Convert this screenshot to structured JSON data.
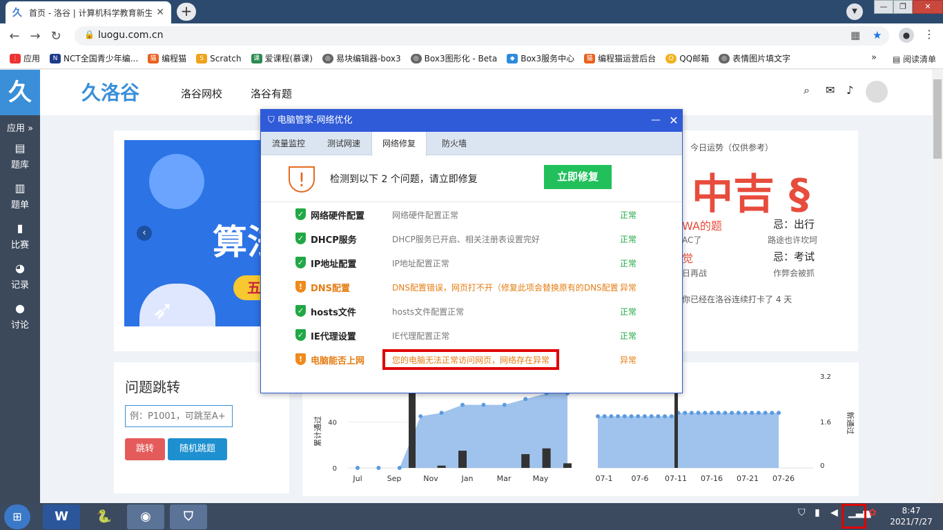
{
  "browser": {
    "tab_title": "首页 - 洛谷 | 计算机科学教育新生态",
    "url": "luogu.com.cn",
    "bookmarks": [
      "应用",
      "NCT全国青少年编...",
      "编程猫",
      "Scratch",
      "爱课程(慕课)",
      "易块编辑器-box3",
      "Box3图形化 - Beta",
      "Box3服务中心",
      "编程猫运营后台",
      "QQ邮箱",
      "表情图片填文字"
    ],
    "more": "»",
    "reading_list": "阅读清单"
  },
  "site": {
    "brand": "洛谷",
    "nav": [
      "洛谷网校",
      "洛谷有题"
    ],
    "sidebar": [
      "应用 »",
      "题库",
      "题单",
      "比赛",
      "记录",
      "讨论"
    ],
    "banner_text": "算法",
    "banner_badge": "五",
    "fortune_label": "今日运势（仅供参考）",
    "fortune_value": "中吉 §",
    "fortune_good_1": "WA的题",
    "fortune_good_1_sub": "AC了",
    "fortune_bad_1": "忌：出行",
    "fortune_bad_1_sub": "路途也许坎坷",
    "fortune_good_2": "觉",
    "fortune_good_2_sub": "日再战",
    "fortune_bad_2": "忌：考试",
    "fortune_bad_2_sub": "作弊会被抓",
    "streak": "你已经在洛谷连续打卡了 4 天",
    "jump_title": "问题跳转",
    "jump_placeholder": "例：P1001，可跳至A+",
    "jump_button": "跳转",
    "random_button": "随机跳题"
  },
  "chart_data": [
    {
      "type": "bar",
      "categories": [
        "Jul",
        "Sep",
        "Nov",
        "Jan",
        "Mar",
        "May"
      ],
      "ylabel": "累计通过",
      "yticks": [
        0,
        40
      ],
      "cumulative_values": [
        0,
        0,
        0,
        45,
        48,
        55,
        55,
        55,
        60,
        65,
        65
      ],
      "bar_values": [
        0,
        0,
        0,
        0,
        2,
        15,
        0,
        0,
        12,
        17,
        4
      ]
    },
    {
      "type": "area",
      "categories": [
        "07-1",
        "07-6",
        "07-11",
        "07-16",
        "07-21",
        "07-26"
      ],
      "ylabel": "新通过",
      "yticks": [
        0,
        1.6,
        3.2
      ],
      "values": [
        0,
        0,
        0,
        0,
        0,
        0,
        0,
        0,
        0,
        0,
        0,
        0,
        0,
        0,
        0,
        0,
        0,
        0,
        0,
        0,
        0,
        0,
        0,
        0,
        0,
        0,
        0,
        0,
        0,
        0
      ],
      "area_level": [
        45,
        45,
        45,
        45,
        45,
        45,
        45,
        45,
        45,
        45,
        45,
        45,
        48,
        48,
        48,
        48,
        48,
        48,
        48,
        48,
        48,
        48,
        48,
        48,
        48,
        48,
        48,
        48
      ]
    }
  ],
  "dialog": {
    "title": "电脑管家-网络优化",
    "tabs": [
      "流量监控",
      "测试网速",
      "网络修复",
      "防火墙"
    ],
    "active_tab": 2,
    "message": "检测到以下 2 个问题，请立即修复",
    "fix_button": "立即修复",
    "rows": [
      {
        "name": "网络硬件配置",
        "desc": "网络硬件配置正常",
        "status": "正常",
        "ok": true
      },
      {
        "name": "DHCP服务",
        "desc": "DHCP服务已开启、相关注册表设置完好",
        "status": "正常",
        "ok": true
      },
      {
        "name": "IP地址配置",
        "desc": "IP地址配置正常",
        "status": "正常",
        "ok": true
      },
      {
        "name": "DNS配置",
        "desc": "DNS配置错误，网页打不开（修复此项会替换原有的DNS配置",
        "status": "异常",
        "ok": false
      },
      {
        "name": "hosts文件",
        "desc": "hosts文件配置正常",
        "status": "正常",
        "ok": true
      },
      {
        "name": "IE代理设置",
        "desc": "IE代理配置正常",
        "status": "正常",
        "ok": true
      },
      {
        "name": "电脑能否上网",
        "desc": "您的电脑无法正常访问网页，网络存在异常",
        "status": "异常",
        "ok": false
      }
    ]
  },
  "taskbar": {
    "time": "8:47",
    "date": "2021/7/27"
  },
  "colors": {
    "accent": "#3a8fd8",
    "dialog_blue": "#2f5bd8",
    "ok_green": "#21a845",
    "warn_orange": "#e57d12",
    "highlight_red": "#e00000"
  }
}
